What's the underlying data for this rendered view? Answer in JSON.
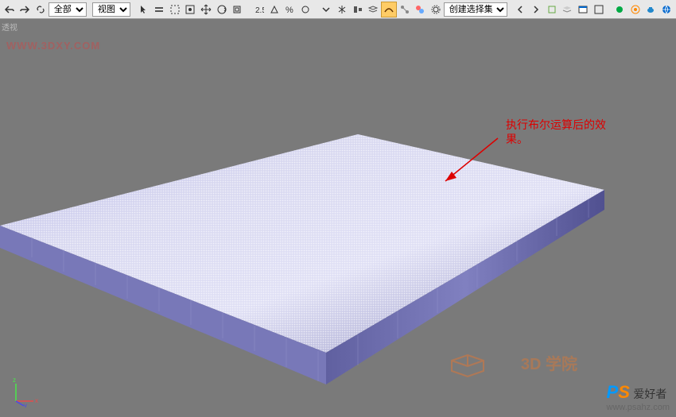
{
  "toolbar": {
    "dropdown1": "全部",
    "dropdown2": "视图",
    "selection_set": "创建选择集"
  },
  "viewport": {
    "label": "透视"
  },
  "annotation": {
    "line1": "执行布尔运算后的效",
    "line2": "果。"
  },
  "watermarks": {
    "url": "WWW.3DXY.COM",
    "logo": "3D 学院",
    "ps_brand": "PS",
    "ps_text": "爱好者",
    "ps_url": "www.psahz.com"
  },
  "chart_data": {
    "type": "3d-mesh",
    "description": "Perforated flat panel with high density circular hole pattern, viewed in perspective, purple/violet wireframe shading"
  }
}
